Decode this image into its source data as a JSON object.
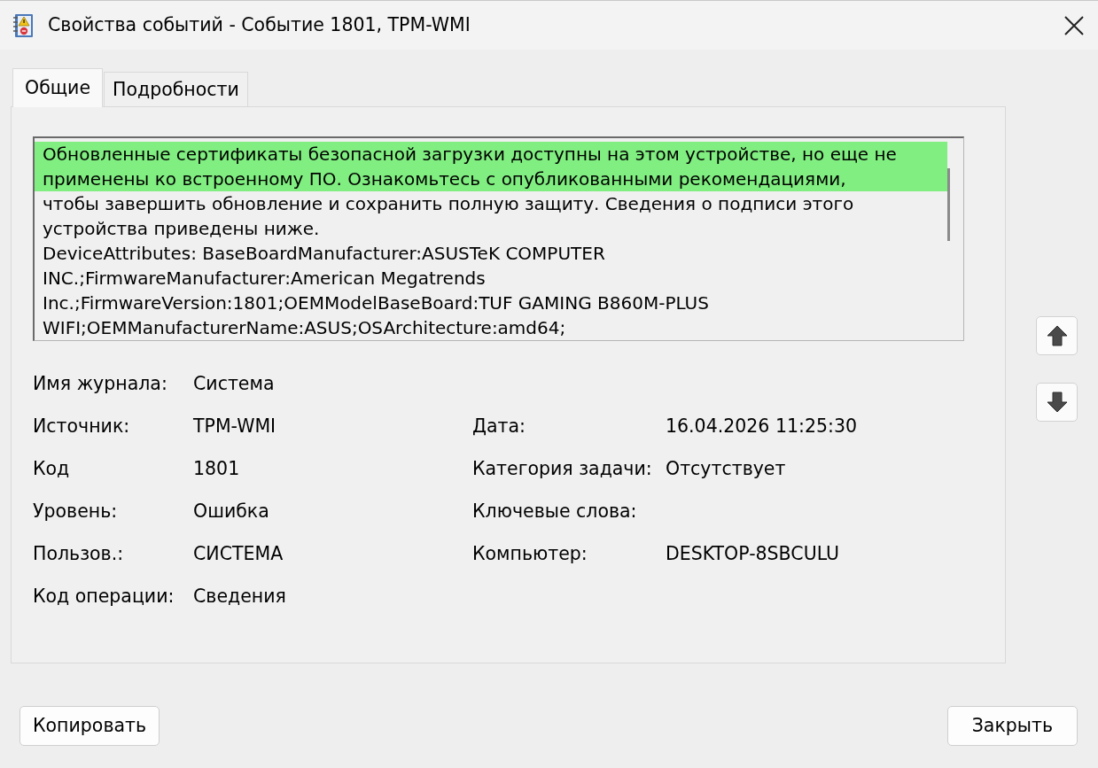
{
  "window": {
    "title": "Свойства событий - Событие 1801, TPM-WMI"
  },
  "tabs": [
    {
      "label": "Общие",
      "selected": true
    },
    {
      "label": "Подробности",
      "selected": false
    }
  ],
  "description": {
    "lines": [
      {
        "text": "Обновленные сертификаты безопасной загрузки доступны на этом устройстве, но еще не",
        "highlighted": true
      },
      {
        "text": "применены ко встроенному ПО. Ознакомьтесь с опубликованными рекомендациями,",
        "highlighted": true
      },
      {
        "text": "чтобы завершить обновление и сохранить полную защиту. Сведения о подписи этого",
        "highlighted": false
      },
      {
        "text": "устройства приведены ниже.",
        "highlighted": false
      },
      {
        "text": "DeviceAttributes: BaseBoardManufacturer:ASUSTeK COMPUTER",
        "highlighted": false
      },
      {
        "text": "INC.;FirmwareManufacturer:American Megatrends",
        "highlighted": false
      },
      {
        "text": "Inc.;FirmwareVersion:1801;OEMModelBaseBoard:TUF GAMING B860M-PLUS",
        "highlighted": false
      },
      {
        "text": "WIFI;OEMManufacturerName:ASUS;OSArchitecture:amd64;",
        "highlighted": false
      }
    ]
  },
  "rows": [
    {
      "left": {
        "label": "Имя журнала:",
        "value": "Система"
      }
    },
    {
      "left": {
        "label": "Источник:",
        "value": "TPM-WMI"
      },
      "right": {
        "label": "Дата:",
        "value": "16.04.2026 11:25:30"
      }
    },
    {
      "left": {
        "label": "Код",
        "value": "1801"
      },
      "right": {
        "label": "Категория задачи:",
        "value": "Отсутствует"
      }
    },
    {
      "left": {
        "label": "Уровень:",
        "value": "Ошибка"
      },
      "right": {
        "label": "Ключевые слова:"
      }
    },
    {
      "left": {
        "label": "Пользов.:",
        "value": "СИСТЕМА"
      },
      "right": {
        "label": "Компьютер:",
        "value": "DESKTOP-8SBCULU"
      }
    },
    {
      "left": {
        "label": "Код операции:",
        "value": "Сведения"
      }
    }
  ],
  "buttons": [
    {
      "label": "Копировать"
    },
    {
      "label": "Закрыть"
    }
  ]
}
